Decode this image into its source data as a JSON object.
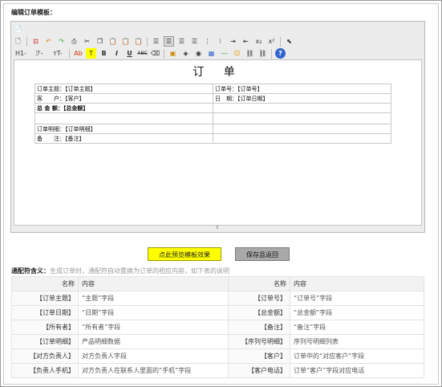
{
  "heading": "编辑订单模板：",
  "toolbar": {
    "heading_label": "H1-",
    "font_label": "ℱ-",
    "size_label": "тT-",
    "forecolor_label": "Ab",
    "bgcolor_label": "T",
    "bold_label": "B",
    "italic_label": "I",
    "underline_label": "U",
    "strike_label": "ABC",
    "subscript_label": "x₂",
    "superscript_label": "x²",
    "help_label": "?"
  },
  "document": {
    "title": "订 单",
    "rows": [
      [
        "订单主题：【订单主题】",
        "订单号：【订单号】"
      ],
      [
        "客　　户：【客户】",
        "日　期：【订单日期】"
      ],
      [
        "总 金 额：【总金额】",
        ""
      ],
      [
        "",
        ""
      ],
      [
        "订单明细：【订单明细】",
        ""
      ],
      [
        "备　　注：【备注】",
        ""
      ]
    ],
    "resize_handle": "⇕"
  },
  "buttons": {
    "preview": "点此预览模板效果",
    "save": "保存且返回"
  },
  "description": {
    "label": "通配符含义：",
    "text": "生成订单时，通配符自动置换为订单的相应内容，如下表的说明"
  },
  "reference": {
    "headers": [
      "名称",
      "内容",
      "名称",
      "内容"
    ],
    "rows": [
      [
        "【订单主题】",
        "“主题”字段",
        "【订单号】",
        "“订单号”字段"
      ],
      [
        "【订单日期】",
        "“日期”字段",
        "【总金额】",
        "“总金额”字段"
      ],
      [
        "【所有者】",
        "“所有者”字段",
        "【备注】",
        "“备注”字段"
      ],
      [
        "【订单明细】",
        "产品明细数据",
        "【序列号明细】",
        "序列号明细列表"
      ],
      [
        "【对方负责人】",
        "对方负责人字段",
        "【客户】",
        "订单中的“对应客户”字段"
      ],
      [
        "【负责人手机】",
        "对方负责人在联系人里面的“手机”字段",
        "【客户电话】",
        "订单“客户”字段对应电话"
      ]
    ]
  }
}
